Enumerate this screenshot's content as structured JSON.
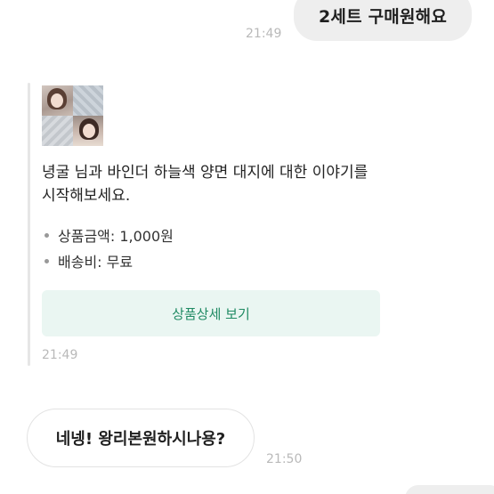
{
  "messages": {
    "outgoing": {
      "text": "2세트 구매원해요",
      "time": "21:49"
    },
    "product_card": {
      "title": "녕굴 님과 바인더 하늘색 양면 대지에 대한 이야기를 시작해보세요.",
      "price_line": "상품금액: 1,000원",
      "shipping_line": "배송비: 무료",
      "detail_button": "상품상세 보기",
      "time": "21:49"
    },
    "incoming": {
      "text": "네넹! 왕리본원하시나용?",
      "time": "21:50"
    }
  },
  "colors": {
    "bubble_gray": "#eeeeee",
    "button_bg": "#eaf6f2",
    "button_text": "#1f8a63",
    "timestamp": "#b9b9b9"
  }
}
